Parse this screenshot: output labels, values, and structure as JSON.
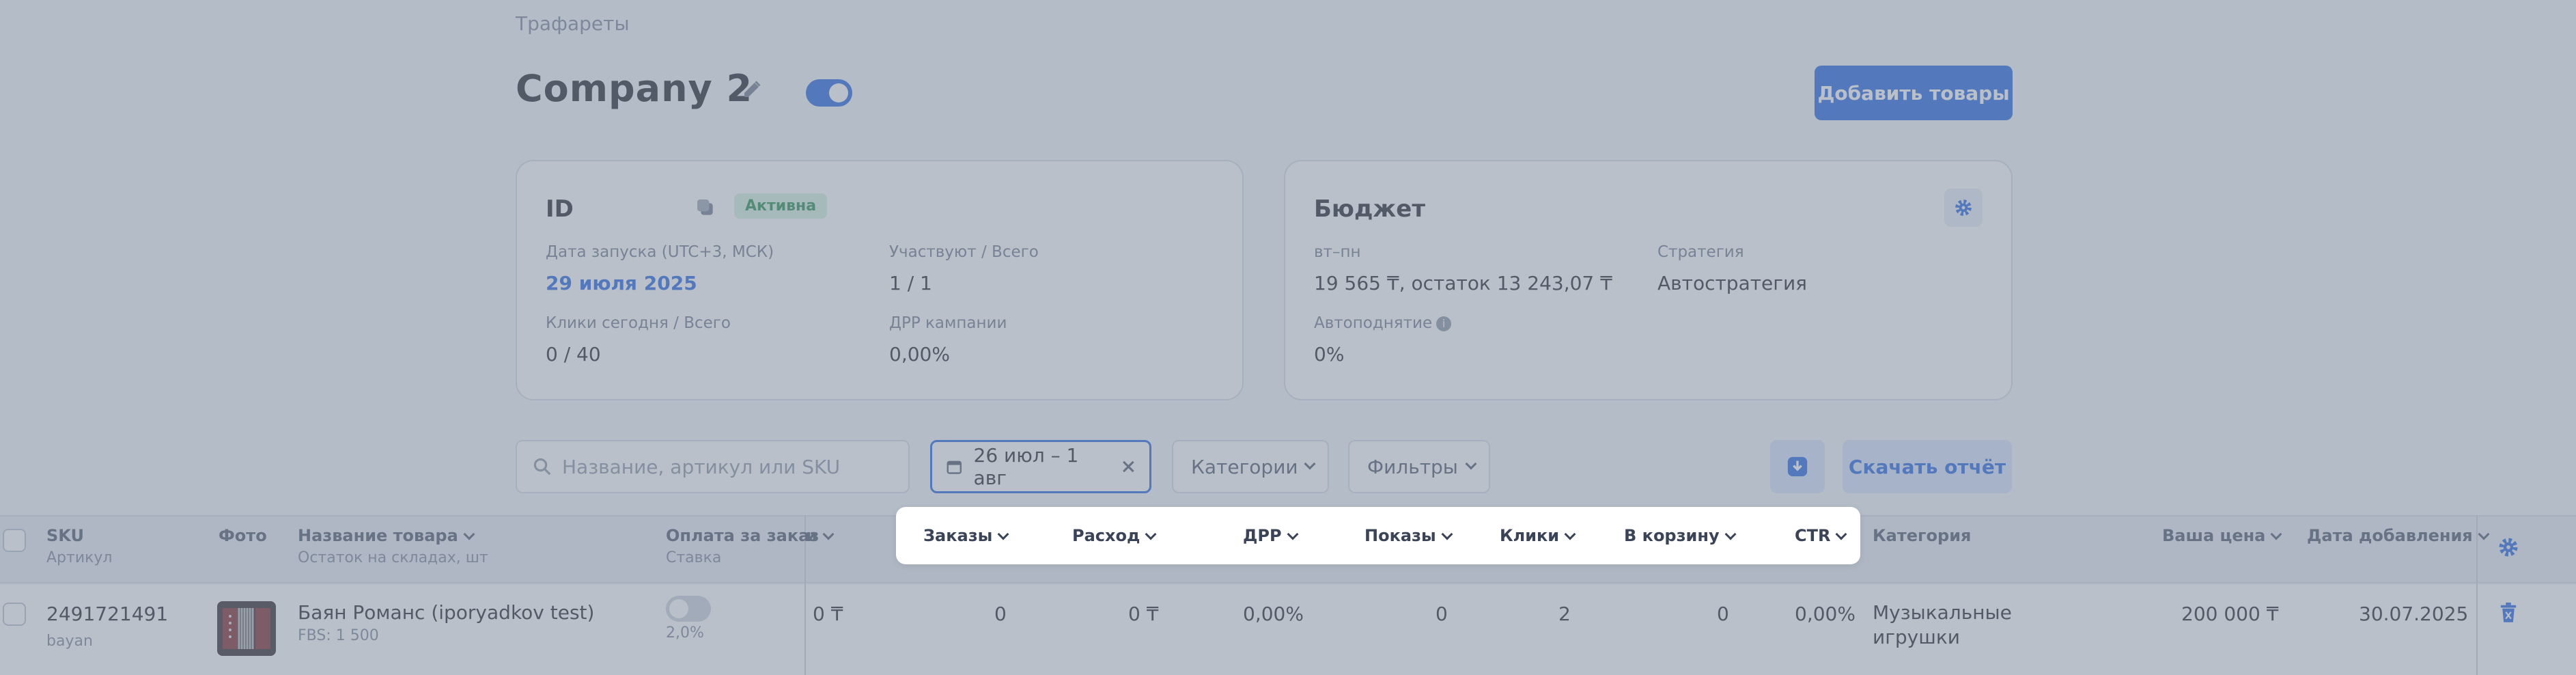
{
  "breadcrumb": "Трафареты",
  "campaign": {
    "title": "Company  2",
    "add_button": "Добавить товары"
  },
  "id_card": {
    "title": "ID",
    "status": "Активна",
    "launch_label": "Дата запуска (UTC+3, МСК)",
    "launch_value": "29 июля 2025",
    "participate_label": "Участвуют / Всего",
    "participate_value": "1 / 1",
    "clicks_label": "Клики сегодня / Всего",
    "clicks_value": "0 / 40",
    "drr_label": "ДРР кампании",
    "drr_value": "0,00%"
  },
  "budget_card": {
    "title": "Бюджет",
    "period_label": "вт–пн",
    "period_value": "19 565 ₸, остаток 13 243,07 ₸",
    "strategy_label": "Стратегия",
    "strategy_value": "Автостратегия",
    "autoraise_label": "Автоподнятие",
    "autoraise_value": "0%"
  },
  "toolbar": {
    "search_placeholder": "Название, артикул или SKU",
    "date_range": "26 июл – 1 авг",
    "categories": "Категории",
    "filters": "Фильтры",
    "report": "Скачать отчёт"
  },
  "table": {
    "headers": {
      "sku": "SKU",
      "article": "Артикул",
      "photo": "Фото",
      "name": "Название товара",
      "stock": "Остаток на складах, шт",
      "pay": "Оплата за заказ",
      "rate": "Ставка",
      "hidden": "и",
      "orders": "Заказы",
      "expense": "Расход",
      "drr": "ДРР",
      "impressions": "Показы",
      "clicks": "Клики",
      "cart": "В корзину",
      "ctr": "CTR",
      "category": "Категория",
      "price": "Ваша цена",
      "added": "Дата добавления"
    },
    "row": {
      "sku": "2491721491",
      "article": "bayan",
      "name": "Баян Романс (iporyadkov test)",
      "stock": "FBS: 1 500",
      "rate": "2,0%",
      "hidden_val": "0 ₸",
      "orders": "0",
      "expense": "0 ₸",
      "drr": "0,00%",
      "impressions": "0",
      "clicks": "2",
      "cart": "0",
      "ctr": "0,00%",
      "category_line1": "Музыкальные",
      "category_line2": "игрушки",
      "price": "200 000 ₸",
      "added": "30.07.2025"
    }
  },
  "colors": {
    "accent": "#1f5fe0",
    "active_badge": "#1e8a48",
    "overlay": "#808c9e"
  }
}
